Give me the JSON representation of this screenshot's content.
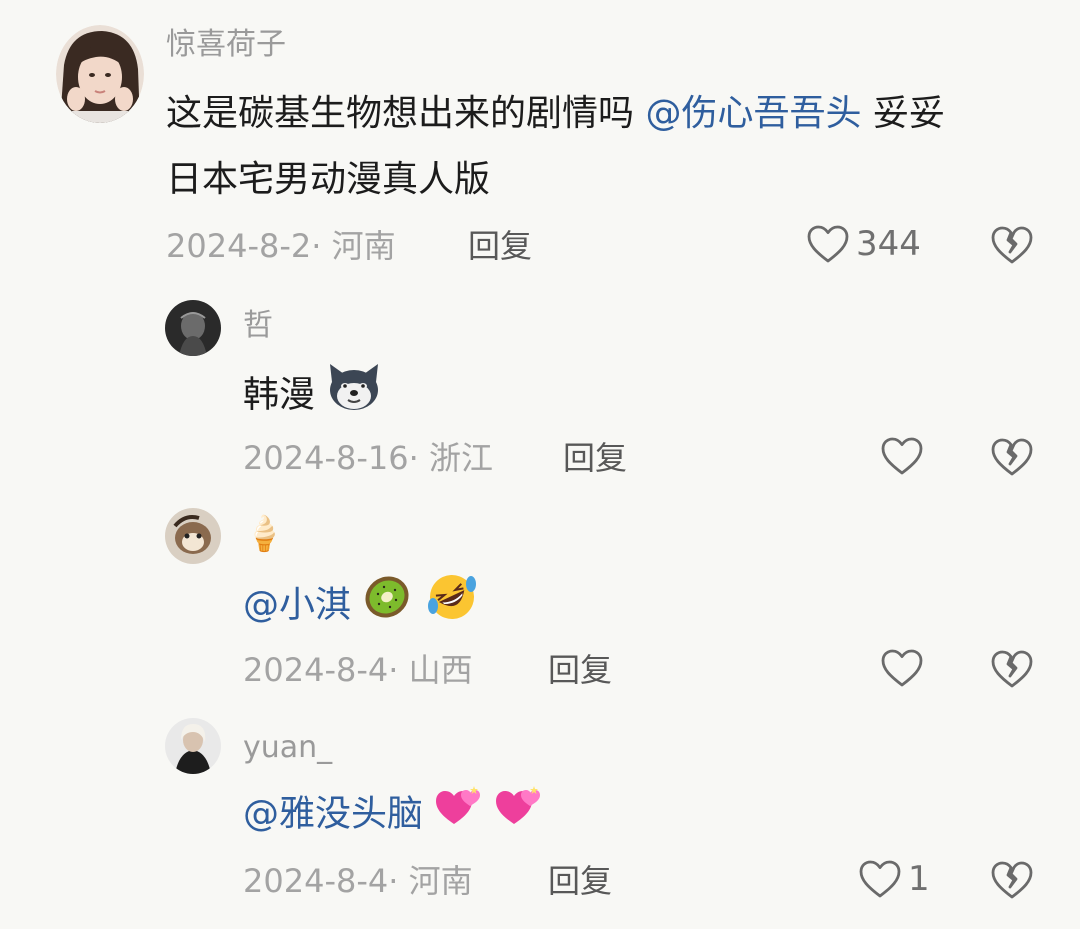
{
  "comments": [
    {
      "username": "惊喜荷子",
      "text_line1": "这是碳基生物想出来的剧情吗 ",
      "mention": "@伤心吾吾头",
      "text_line1_suffix": " 妥妥",
      "text_line2": "日本宅男动漫真人版",
      "meta": "2024-8-2· 河南",
      "reply_label": "回复",
      "likes": "344"
    }
  ],
  "replies": [
    {
      "username": "哲",
      "text": "韩漫",
      "emoji": [
        "dog-face-emoji"
      ],
      "meta": "2024-8-16· 浙江",
      "reply_label": "回复",
      "likes": ""
    },
    {
      "username": "🍦",
      "mention": "@小淇",
      "emoji": [
        "kiwi-emoji",
        "rolling-laughing-emoji"
      ],
      "meta": "2024-8-4· 山西",
      "reply_label": "回复",
      "likes": ""
    },
    {
      "username": "yuan_",
      "mention": "@雅没头脑",
      "emoji": [
        "two-hearts-emoji",
        "two-hearts-emoji"
      ],
      "meta": "2024-8-4· 河南",
      "reply_label": "回复",
      "likes": "1"
    }
  ],
  "colors": {
    "background": "#f8f8f5",
    "mention": "#2f5e9e",
    "meta": "#a3a3a3",
    "text": "#1c1c1c"
  }
}
